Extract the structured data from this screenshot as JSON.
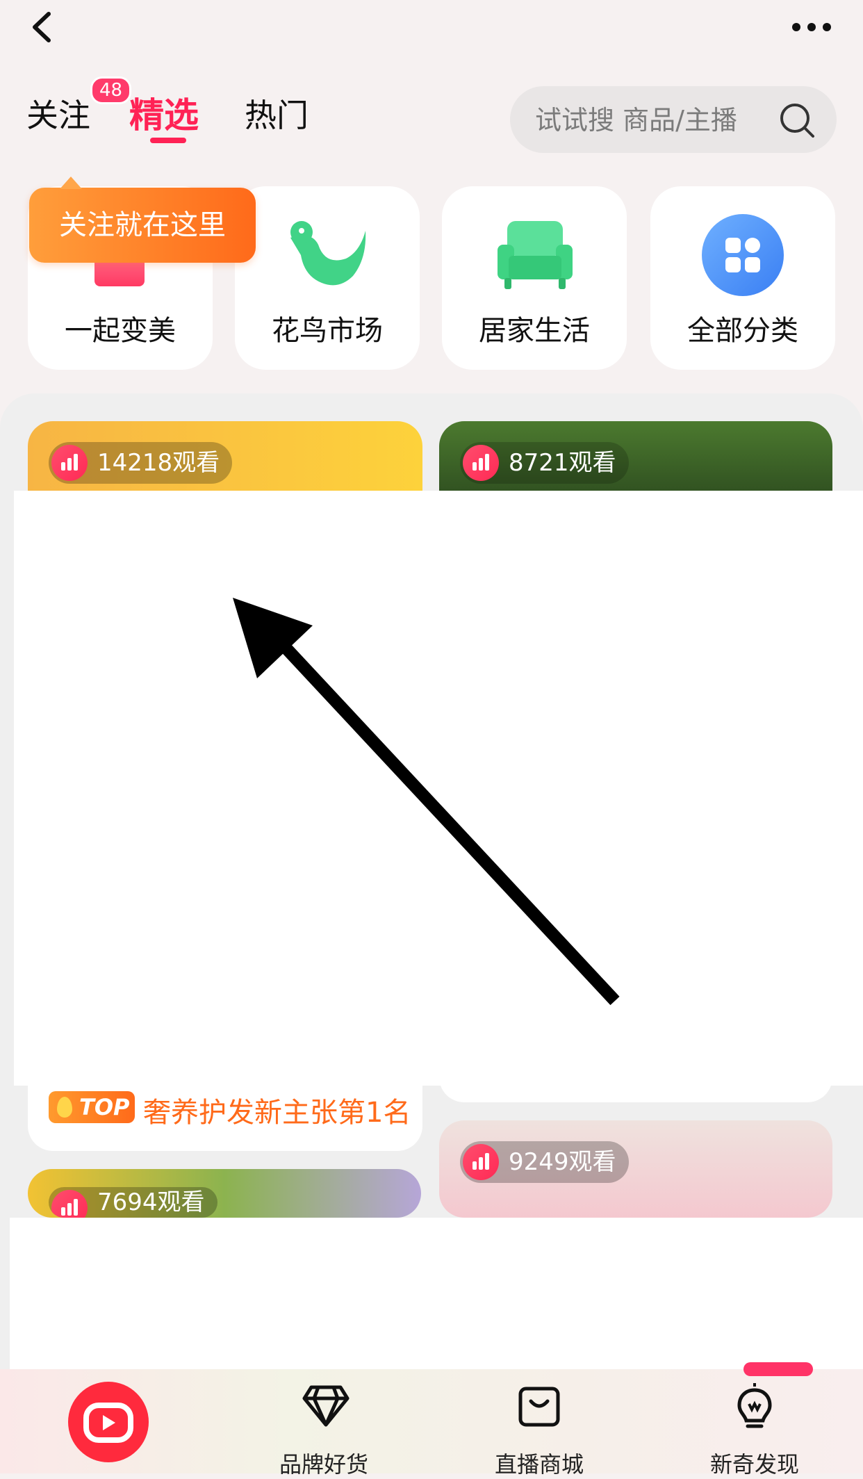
{
  "header": {
    "tabs": [
      {
        "label": "关注",
        "badge": "48"
      },
      {
        "label": "精选",
        "active": true
      },
      {
        "label": "热门"
      }
    ],
    "search_placeholder": "试试搜 商品/主播"
  },
  "categories": [
    {
      "label": "一起变美",
      "icon": "beauty-icon"
    },
    {
      "label": "花鸟市场",
      "icon": "bird-icon"
    },
    {
      "label": "居家生活",
      "icon": "sofa-icon"
    },
    {
      "label": "全部分类",
      "icon": "grid-icon"
    }
  ],
  "tooltip": "关注就在这里",
  "feed": {
    "cards": [
      {
        "views": "14218观看"
      },
      {
        "views": "8721观看"
      },
      {
        "views": "9249观看"
      },
      {
        "views": "7694观看"
      }
    ],
    "top_badge": "TOP",
    "top_text": "奢养护发新主张第1名"
  },
  "bottom_nav": {
    "items": [
      {
        "label": "品牌好货",
        "icon": "diamond-icon"
      },
      {
        "label": "直播商城",
        "icon": "shopping-bag-icon"
      },
      {
        "label": "新奇发现",
        "icon": "lightbulb-icon"
      }
    ]
  },
  "colors": {
    "accent": "#ff2255",
    "orange": "#ff6a1a",
    "green": "#3fd383",
    "blue": "#4a8ef7"
  }
}
